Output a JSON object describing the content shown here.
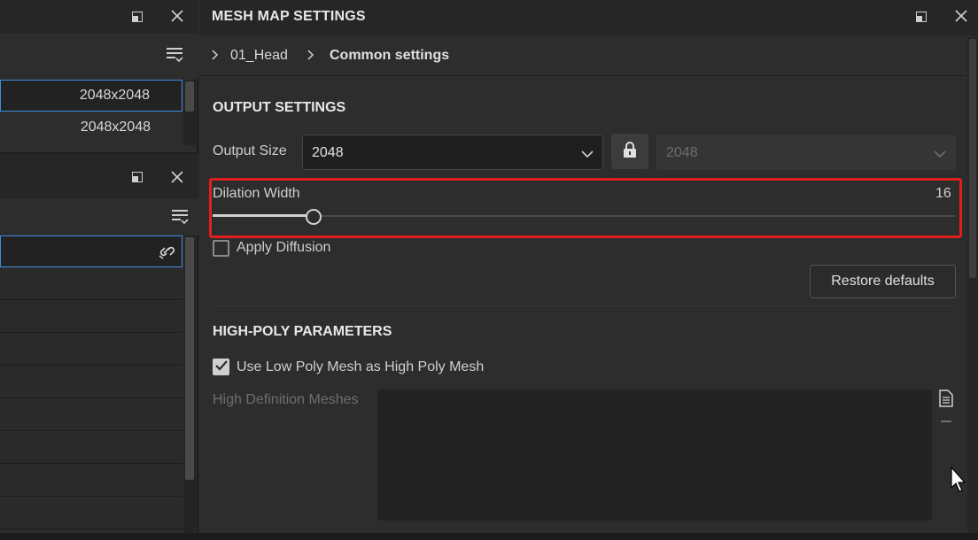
{
  "left_panel": {
    "top_rows": [
      {
        "value": "2048x2048",
        "selected": true
      },
      {
        "value": "2048x2048",
        "selected": false
      }
    ]
  },
  "main": {
    "title": "MESH MAP SETTINGS",
    "breadcrumb": {
      "item1": "01_Head",
      "item2": "Common settings"
    },
    "output_settings": {
      "title": "OUTPUT SETTINGS",
      "output_size_label": "Output Size",
      "output_size_value": "2048",
      "output_size_linked_value": "2048",
      "dilation_width_label": "Dilation Width",
      "dilation_width_value": "16",
      "dilation_slider_fraction": 0.136,
      "apply_diffusion_label": "Apply Diffusion",
      "apply_diffusion_checked": false,
      "restore_defaults_label": "Restore defaults"
    },
    "high_poly": {
      "title": "HIGH-POLY PARAMETERS",
      "use_low_poly_label": "Use Low Poly Mesh as High Poly Mesh",
      "use_low_poly_checked": true,
      "high_def_meshes_label": "High Definition Meshes"
    }
  },
  "colors": {
    "highlight_border": "#e01f1f",
    "selection_border": "#3f8de0",
    "background": "#2d2d2d"
  },
  "icons": [
    "restore-window-icon",
    "close-icon",
    "list-filter-icon",
    "link-icon",
    "chevron-right-icon",
    "chevron-down-icon",
    "lock-icon",
    "document-icon",
    "minus-icon",
    "checkmark-icon",
    "mouse-cursor-icon"
  ]
}
